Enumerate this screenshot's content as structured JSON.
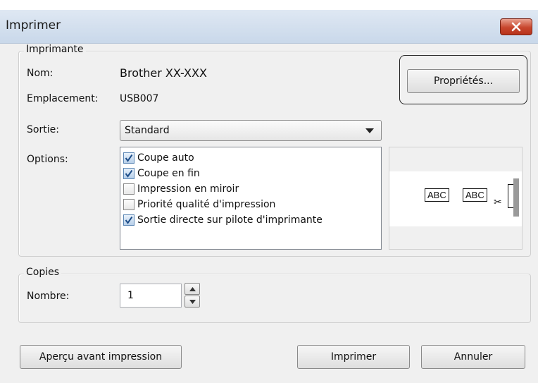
{
  "window": {
    "title": "Imprimer"
  },
  "printer": {
    "group_label": "Imprimante",
    "name_label": "Nom:",
    "name_value": "Brother XX-XXX",
    "location_label": "Emplacement:",
    "location_value": "USB007",
    "properties_button": "Propriétés..."
  },
  "output": {
    "label": "Sortie:",
    "selected": "Standard"
  },
  "options": {
    "label": "Options:",
    "items": [
      {
        "label": "Coupe auto",
        "checked": true
      },
      {
        "label": "Coupe en fin",
        "checked": true
      },
      {
        "label": "Impression en miroir",
        "checked": false
      },
      {
        "label": "Priorité qualité d'impression",
        "checked": false
      },
      {
        "label": "Sortie directe sur pilote d'imprimante",
        "checked": true
      }
    ]
  },
  "preview": {
    "label_1": "ABC",
    "label_2": "ABC",
    "cut_icon": "scissors-icon"
  },
  "copies": {
    "group_label": "Copies",
    "number_label": "Nombre:",
    "number_value": "1"
  },
  "buttons": {
    "preview": "Aperçu avant impression",
    "print": "Imprimer",
    "cancel": "Annuler"
  },
  "colors": {
    "close_button": "#c8462d",
    "checkbox_tick": "#1f4f8a",
    "titlebar": "#c9d8ea"
  }
}
